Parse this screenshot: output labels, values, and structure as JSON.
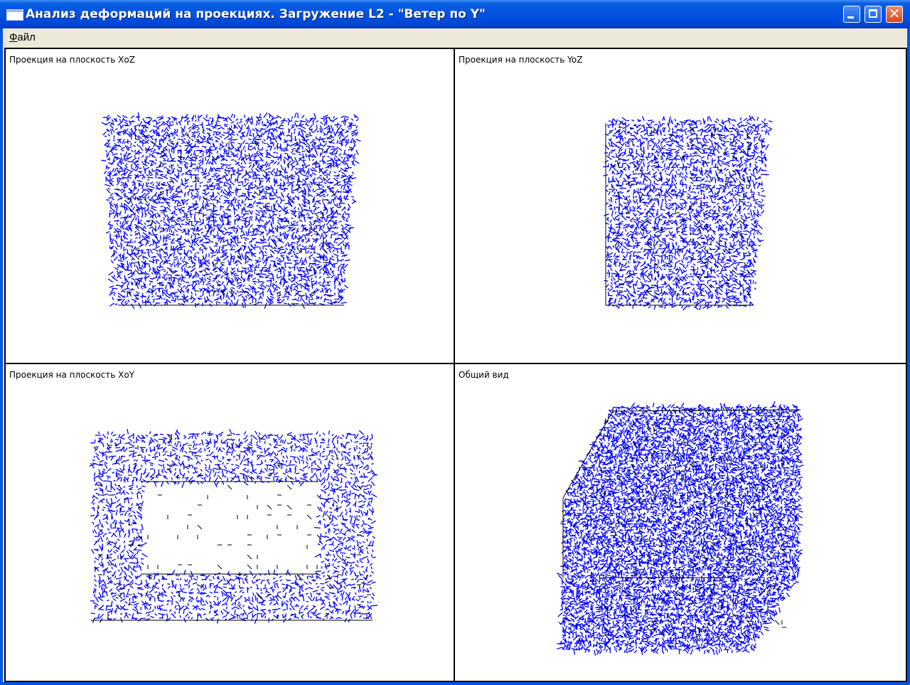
{
  "window": {
    "title": "Анализ деформаций на проекциях. Загружение L2 - \"Ветер по Y\"",
    "colors": {
      "mesh": "#0000ff",
      "frame": "#000000",
      "titlebar": "#0054e3"
    }
  },
  "menu": {
    "file_hotkey": "Ф",
    "file_rest": "айл"
  },
  "panes": {
    "xoz": {
      "label": "Проекция на плоскость XoZ"
    },
    "yoz": {
      "label": "Проекция на плоскость YoZ"
    },
    "xoy": {
      "label": "Проекция на плоскость XoY"
    },
    "iso": {
      "label": "Общий вид"
    }
  }
}
